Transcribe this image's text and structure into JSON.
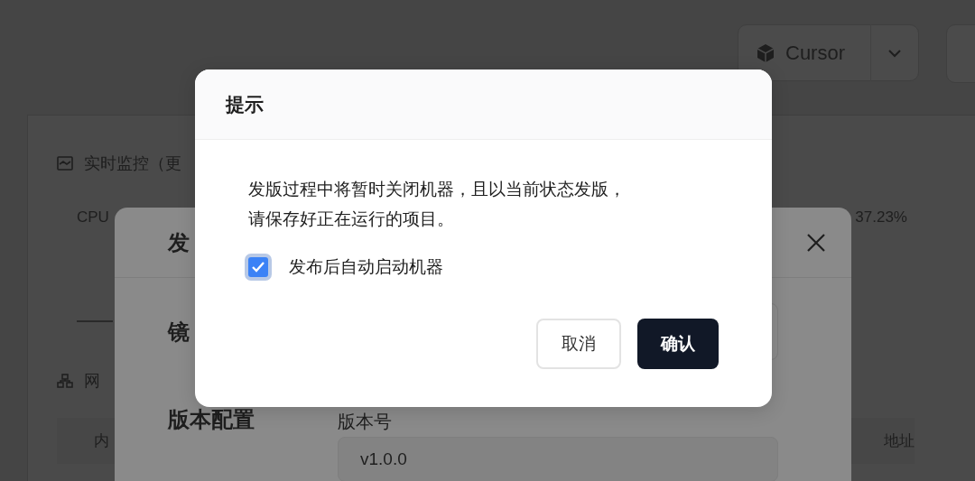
{
  "toolbar": {
    "model_select": {
      "label": "Cursor"
    }
  },
  "monitor": {
    "title": "实时监控（更",
    "cpu_label": "CPU",
    "cpu_value": "37.23%"
  },
  "network": {
    "title": "网",
    "column_1": "内",
    "column_2": "地址"
  },
  "publish_dialog": {
    "title": "发",
    "image_label": "镜",
    "version_section": "版本配置",
    "version_label": "版本号",
    "version_value": "v1.0.0"
  },
  "confirm_dialog": {
    "title": "提示",
    "message_lines": [
      "发版过程中将暂时关闭机器，且以当前状态发版，",
      "请保存好正在运行的项目。"
    ],
    "auto_start": {
      "label": "发布后自动启动机器",
      "checked": true
    },
    "buttons": [
      {
        "label": "取消",
        "kind": "secondary"
      },
      {
        "label": "确认",
        "kind": "primary"
      }
    ]
  }
}
